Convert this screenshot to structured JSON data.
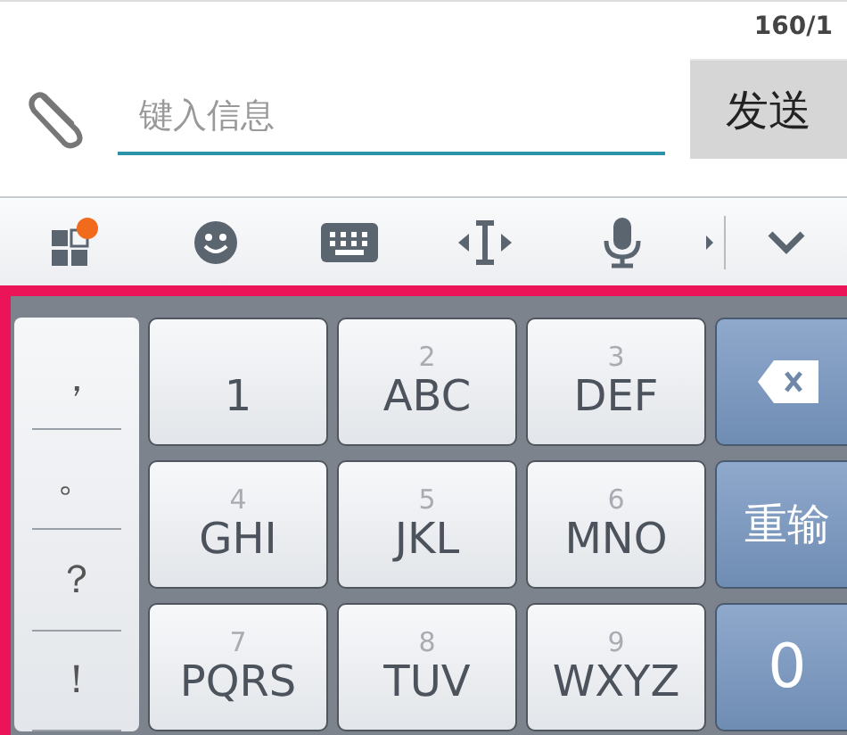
{
  "counter": "160/1",
  "message": {
    "placeholder": "键入信息",
    "send": "发送"
  },
  "toolbar": {
    "items": [
      {
        "kind": "apps",
        "badge": true
      },
      {
        "kind": "emoji"
      },
      {
        "kind": "keyboard"
      },
      {
        "kind": "cursor"
      },
      {
        "kind": "mic"
      },
      {
        "kind": "more"
      },
      {
        "kind": "collapse"
      }
    ]
  },
  "keyboard": {
    "punctuation": [
      "，",
      "。",
      "？",
      "！"
    ],
    "rows": [
      {
        "keys": [
          {
            "letters": "1"
          },
          {
            "digit": "2",
            "letters": "ABC"
          },
          {
            "digit": "3",
            "letters": "DEF"
          }
        ]
      },
      {
        "keys": [
          {
            "digit": "4",
            "letters": "GHI"
          },
          {
            "digit": "5",
            "letters": "JKL"
          },
          {
            "digit": "6",
            "letters": "MNO"
          }
        ]
      },
      {
        "keys": [
          {
            "digit": "7",
            "letters": "PQRS"
          },
          {
            "digit": "8",
            "letters": "TUV"
          },
          {
            "digit": "9",
            "letters": "WXYZ"
          }
        ]
      }
    ],
    "side": [
      {
        "kind": "backspace"
      },
      {
        "kind": "text",
        "label": "重输"
      },
      {
        "kind": "text",
        "label": "0"
      }
    ]
  }
}
